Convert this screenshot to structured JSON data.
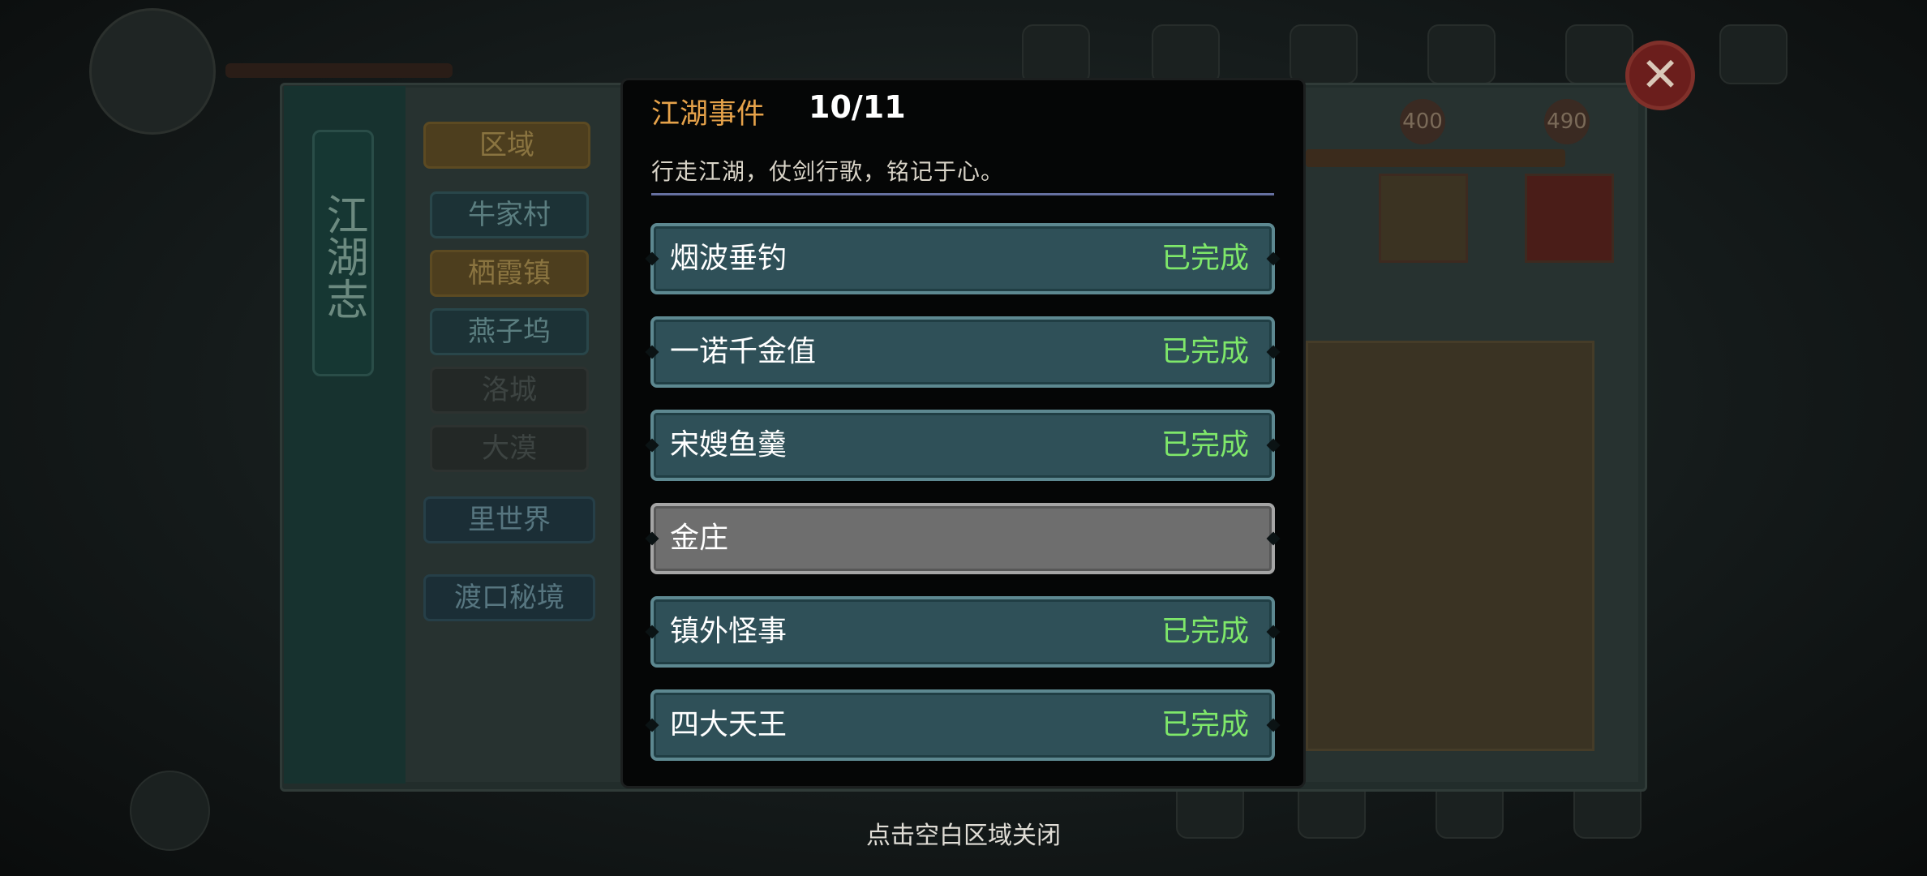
{
  "modal": {
    "title": "江湖事件",
    "count": "10/11",
    "subtitle": "行走江湖，仗剑行歌，铭记于心。",
    "events": [
      {
        "name": "烟波垂钓",
        "status": "已完成",
        "completed": true
      },
      {
        "name": "一诺千金值",
        "status": "已完成",
        "completed": true
      },
      {
        "name": "宋嫂鱼羹",
        "status": "已完成",
        "completed": true
      },
      {
        "name": "金庄",
        "status": "",
        "completed": false
      },
      {
        "name": "镇外怪事",
        "status": "已完成",
        "completed": true
      },
      {
        "name": "四大天王",
        "status": "已完成",
        "completed": true
      }
    ],
    "close_hint": "点击空白区域关闭"
  },
  "background": {
    "book_title": "江湖志",
    "region_tab": "区域",
    "regions": [
      {
        "label": "牛家村",
        "state": "normal"
      },
      {
        "label": "栖霞镇",
        "state": "selected"
      },
      {
        "label": "燕子坞",
        "state": "normal"
      },
      {
        "label": "洛城",
        "state": "locked"
      },
      {
        "label": "大漠",
        "state": "locked"
      }
    ],
    "inner_world": "里世界",
    "ferry_realm": "渡口秘境",
    "progress_badges": [
      "400",
      "490"
    ]
  },
  "colors": {
    "accent_title": "#e6a24a",
    "completed_green": "#7fe86a",
    "row_done_bg": "#2f5058",
    "row_todo_bg": "#6e6e6e",
    "close_red": "#6b1e1c"
  },
  "icons": {
    "close": "close-icon"
  }
}
